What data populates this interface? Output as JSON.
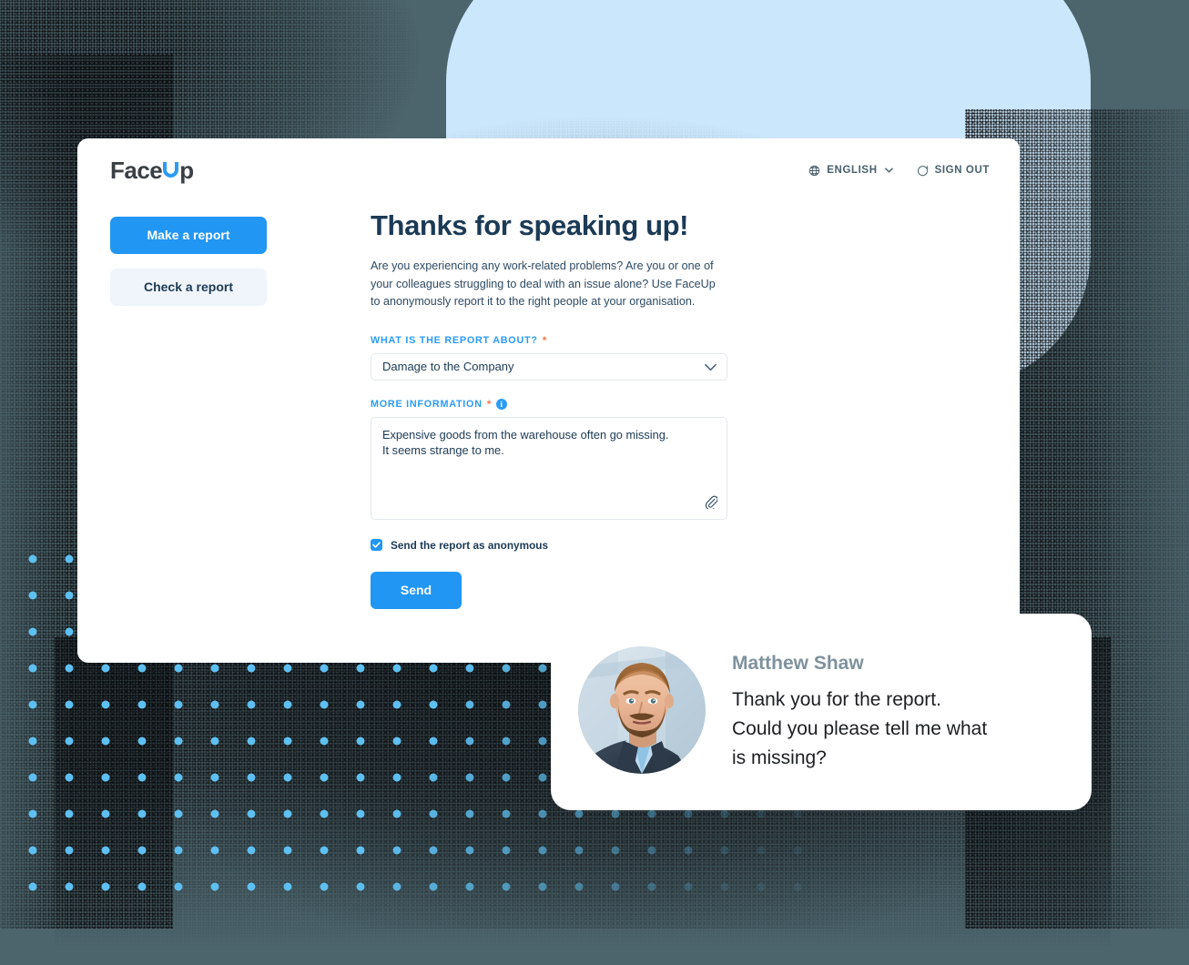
{
  "header": {
    "logo": {
      "part1": "Face",
      "part2": "U",
      "part3": "p"
    },
    "language_button": {
      "label": "ENGLISH",
      "icon": "globe-icon",
      "chevron": "chevron-down-icon"
    },
    "signout_button": {
      "label": "SIGN OUT",
      "icon": "sign-out-icon"
    }
  },
  "sidebar": {
    "items": [
      {
        "label": "Make a report",
        "active": true
      },
      {
        "label": "Check a report",
        "active": false
      }
    ]
  },
  "main": {
    "title": "Thanks for speaking up!",
    "description": "Are you experiencing any work-related problems? Are you or one of your colleagues struggling to deal with an issue alone? Use FaceUp to anonymously report it to the right people at your organisation.",
    "report_about": {
      "label": "WHAT IS THE REPORT ABOUT?",
      "required_mark": "*",
      "value": "Damage to the Company"
    },
    "more_information": {
      "label": "MORE INFORMATION",
      "required_mark": "*",
      "info_glyph": "i",
      "value": "Expensive goods from the warehouse often go missing.\nIt seems strange to me.",
      "attach_icon": "paperclip-icon"
    },
    "anonymous_checkbox": {
      "label": "Send the report as anonymous",
      "checked": true
    },
    "send_button": {
      "label": "Send"
    }
  },
  "chat": {
    "author": "Matthew Shaw",
    "message": "Thank you for the report.\nCould you please tell me what\nis missing?",
    "avatar_alt": "avatar-photo"
  },
  "colors": {
    "background": "#4c646c",
    "blue_blob": "#cbe7fb",
    "accent": "#2196f3",
    "label_blue": "#2b9cf4",
    "dot": "#5ec0f2",
    "heading": "#1b3a56",
    "required": "#ef7b4e",
    "chat_name": "#7e929e"
  }
}
